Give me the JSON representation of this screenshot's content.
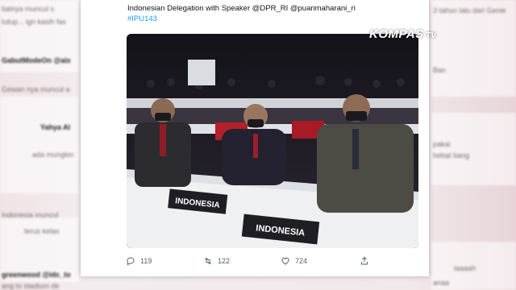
{
  "tweet": {
    "caption_line1": "Indonesian Delegation with Speaker @DPR_RI @puanmaharani_ri",
    "caption_line2": "#IPU143",
    "photo": {
      "placard_left": "INDONESIA",
      "placard_right": "INDONESIA"
    },
    "actions": {
      "reply_count": "119",
      "retweet_count": "122",
      "like_count": "724"
    }
  },
  "watermark": {
    "brand": "KOMPAS",
    "suffix": "TV"
  },
  "background_tweets": {
    "left": [
      "tiatnya muncul s",
      "tutup... ign kasih fas",
      "GabutModeOn @alx",
      "Gewan nya muncul a",
      "Yahya Al",
      "ada mungkin",
      "Indonesia muncul",
      "terus kelas",
      "greenwood @idc_to",
      "ang to stadium de"
    ],
    "right": [
      "3 tahun lalu dari Genie",
      "Ban",
      "pakai",
      "hebat bang",
      "iaaaah",
      "anaa"
    ]
  },
  "colors": {
    "link": "#1d9bf0",
    "text": "#0f1419",
    "muted": "#536471"
  }
}
